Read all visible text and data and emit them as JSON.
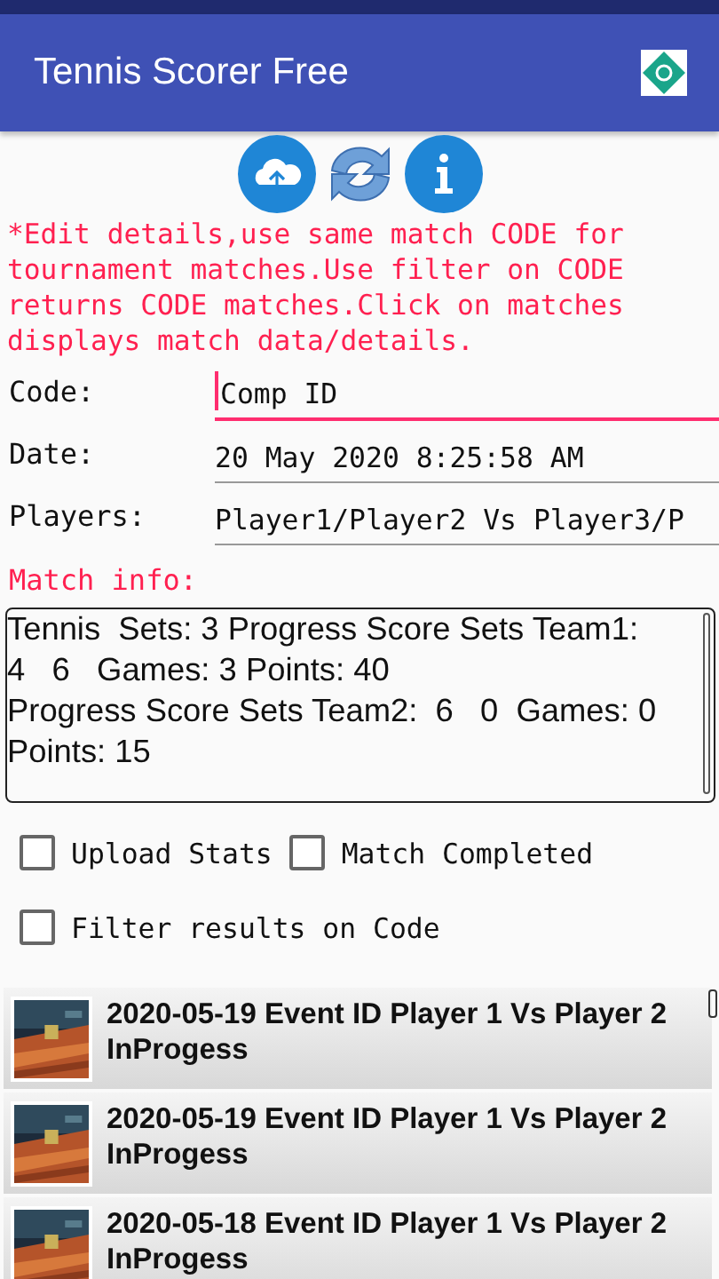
{
  "app_bar": {
    "title": "Tennis Scorer Free"
  },
  "instructions": "*Edit details,use same match CODE for tournament matches.Use filter on CODE returns CODE matches.Click on matches displays match data/details.",
  "fields": [
    {
      "label": "Code:",
      "value": "Comp ID",
      "focused": true
    },
    {
      "label": "Date:",
      "value": "20 May 2020 8:25:58 AM",
      "focused": false
    },
    {
      "label": "Players:",
      "value": "Player1/Player2 Vs Player3/P",
      "focused": false
    }
  ],
  "match_info": {
    "label": "Match info:",
    "lines": [
      "Tennis  Sets: 3 Progress Score Sets Team1:",
      "4   6   Games: 3 Points: 40",
      "Progress Score Sets Team2:  6   0  Games: 0",
      "Points: 15"
    ]
  },
  "checkboxes": [
    {
      "label": "Upload Stats",
      "checked": false
    },
    {
      "label": "Match Completed",
      "checked": false
    },
    {
      "label": "Filter results on Code",
      "checked": false
    }
  ],
  "matches": [
    {
      "text": "2020-05-19 Event ID Player 1 Vs Player 2 InProgess"
    },
    {
      "text": "2020-05-19 Event ID Player 1 Vs Player 2 InProgess"
    },
    {
      "text": "2020-05-18 Event ID Player 1 Vs Player 2 InProgess"
    }
  ]
}
